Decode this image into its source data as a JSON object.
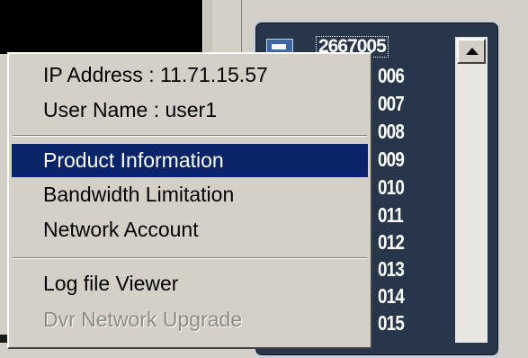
{
  "context_menu": {
    "info": {
      "ip_address": "IP Address : 11.71.15.57",
      "user_name": "User Name : user1"
    },
    "items": [
      {
        "label": "Product Information",
        "state": "selected"
      },
      {
        "label": "Bandwidth Limitation",
        "state": "normal"
      },
      {
        "label": "Network Account",
        "state": "normal"
      },
      {
        "label": "Log file Viewer",
        "state": "normal"
      },
      {
        "label": "Dvr Network Upgrade",
        "state": "disabled"
      }
    ]
  },
  "channel_panel": {
    "title": "2667005",
    "channels": [
      "006",
      "007",
      "008",
      "009",
      "010",
      "011",
      "012",
      "013",
      "014",
      "015"
    ],
    "colors": {
      "panel_bg": "#27364b",
      "text": "#ffffff",
      "highlight": "#0a246a"
    }
  }
}
